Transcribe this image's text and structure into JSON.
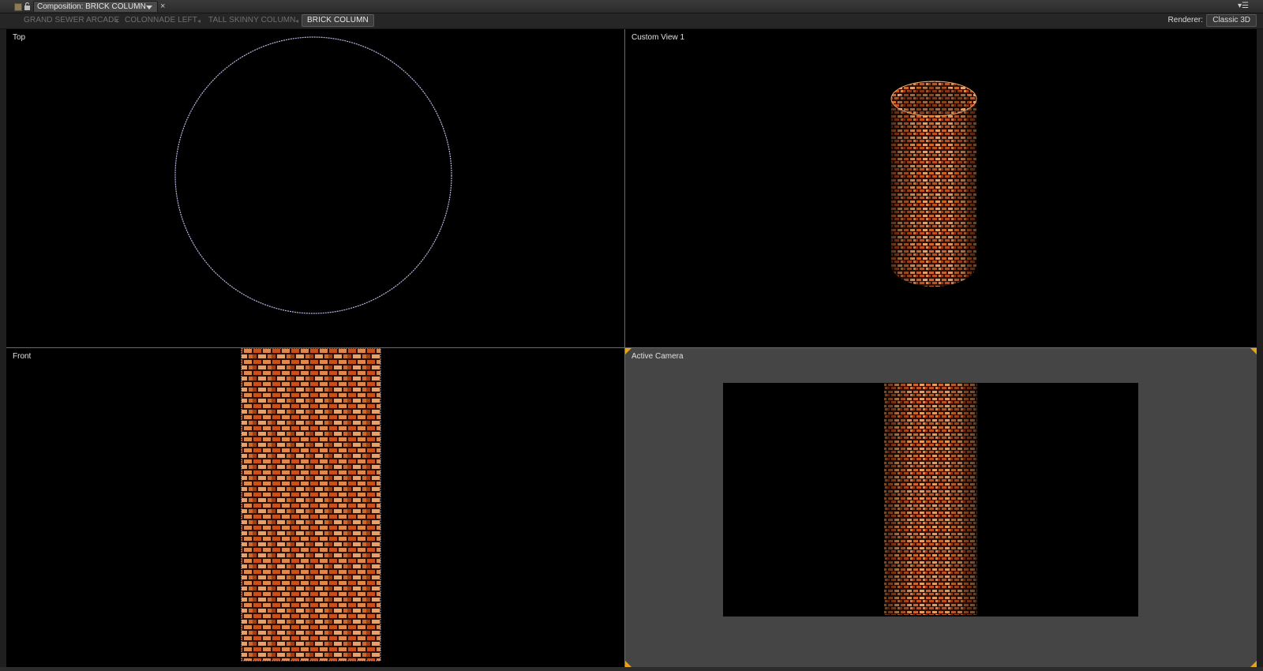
{
  "panel": {
    "comp_tab_label": "Composition: BRICK COLUMN",
    "close_glyph": "×",
    "menu_glyph": "▾☰"
  },
  "navigator": {
    "crumbs": [
      "GRAND SEWER ARCADE",
      "COLONNADE LEFT",
      "TALL SKINNY COLUMN",
      "BRICK COLUMN"
    ],
    "separator": "◂",
    "renderer_label": "Renderer:",
    "renderer_value": "Classic 3D"
  },
  "viewports": {
    "top": "Top",
    "custom": "Custom View 1",
    "front": "Front",
    "active": "Active Camera"
  },
  "colors": {
    "brick_dark": "#6e2a0c",
    "brick_mid": "#c9501c",
    "brick_light": "#e8a066",
    "mortar": "#2a1206",
    "circle_stroke": "#b8b8e6",
    "corner_marker": "#e3a41a"
  },
  "icons": {
    "grip": "panel-grip-icon",
    "lock": "lock-icon",
    "dropdown": "chevron-down-icon",
    "close": "close-icon",
    "menu": "panel-menu-icon"
  }
}
